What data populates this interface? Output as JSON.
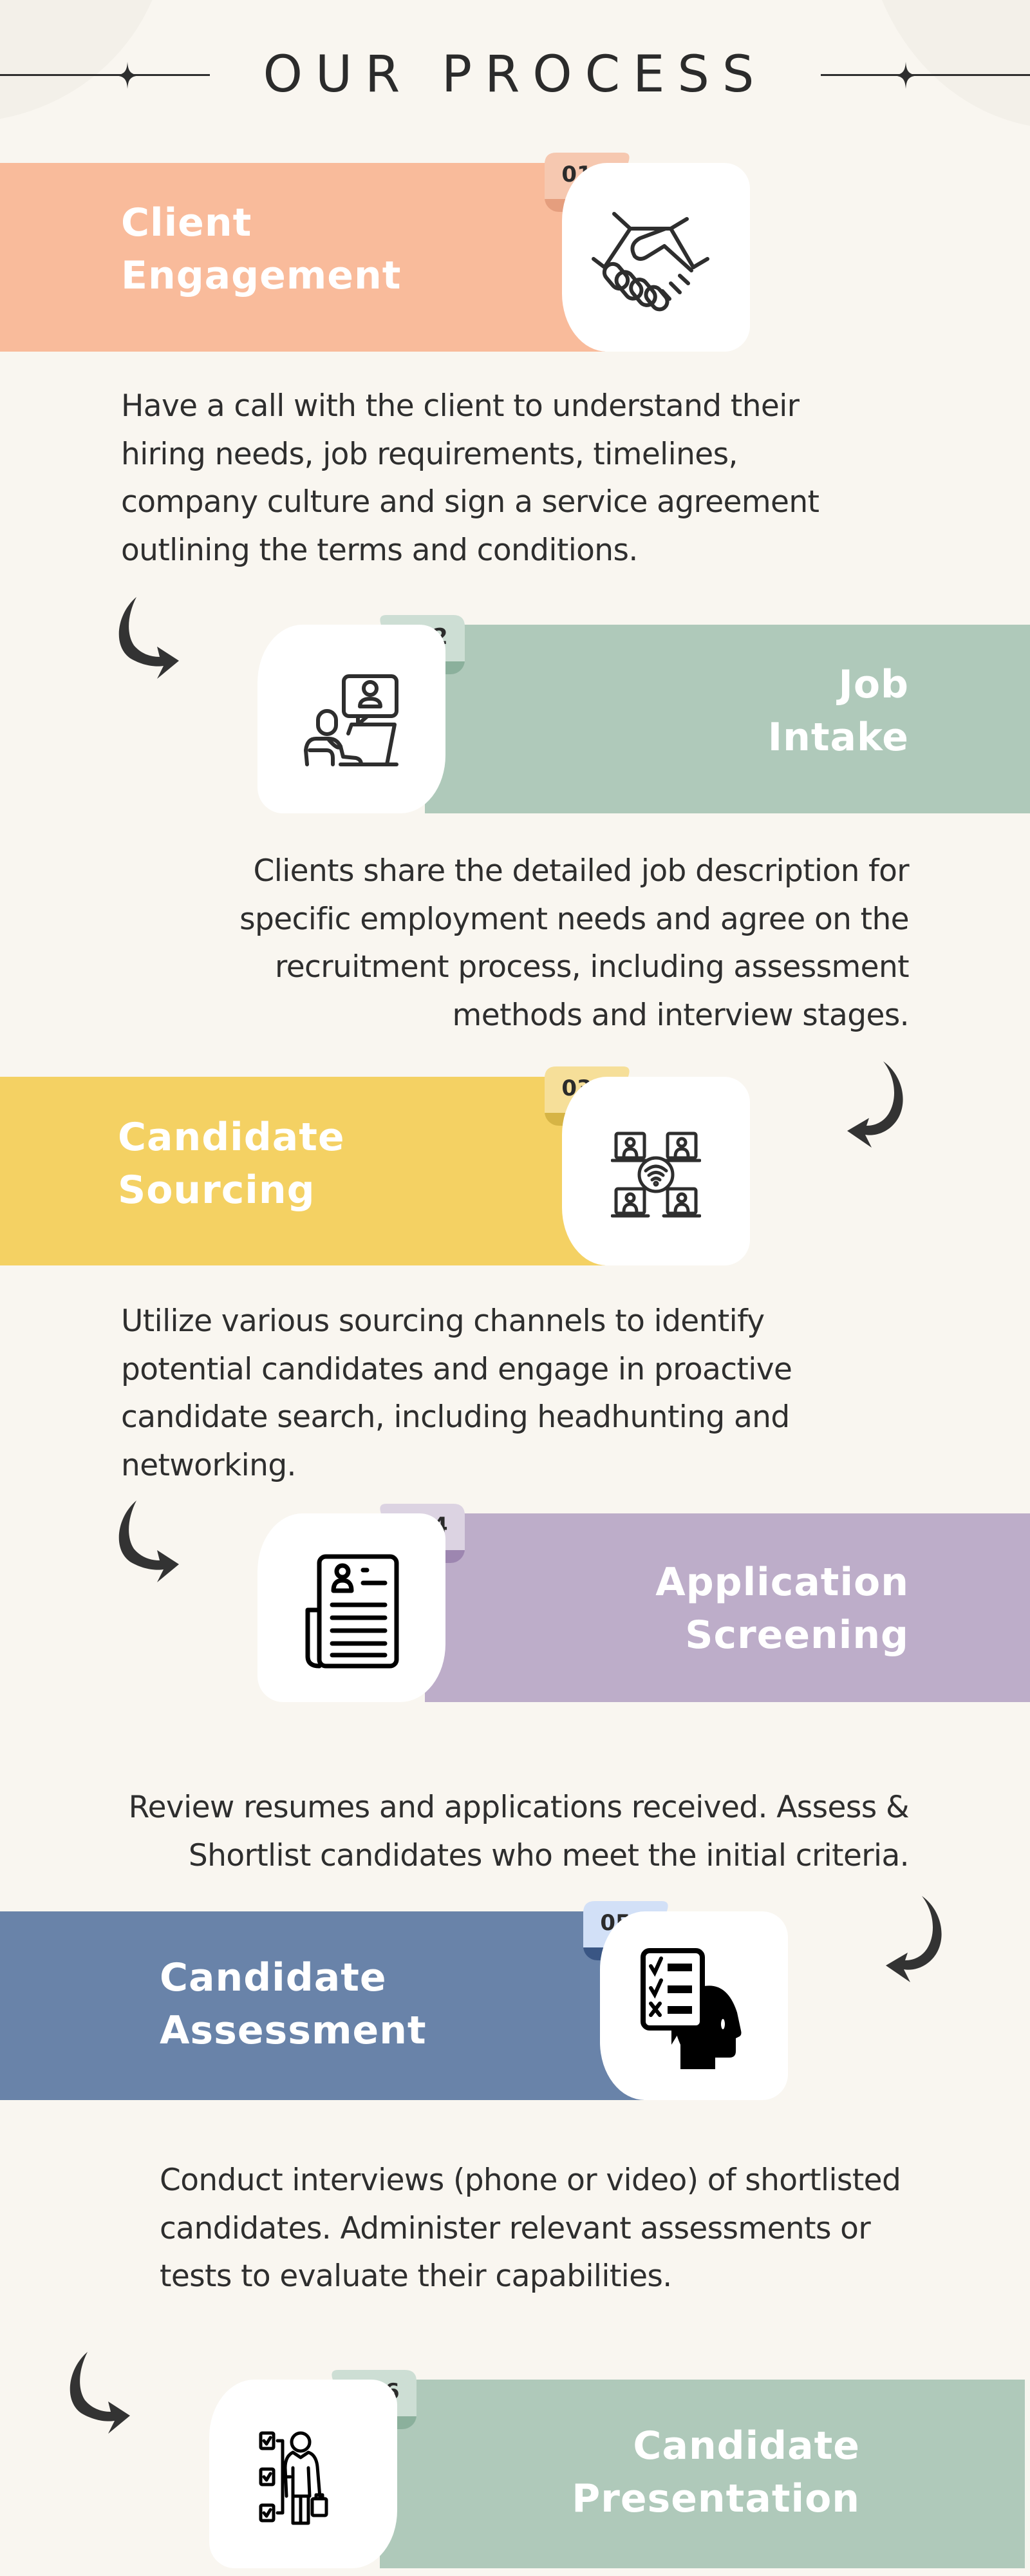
{
  "page": {
    "title": "OUR PROCESS",
    "background_color": "#f9f6f0",
    "text_color": "#2e2e2e"
  },
  "steps": [
    {
      "number": "01",
      "title_lines": [
        "Client",
        "Engagement"
      ],
      "icon": "handshake-icon",
      "banner_color": "#f9bb9b",
      "tab_color": "#f6c8b0",
      "fold_color": "#e59e7e",
      "description_lines": [
        "Have a call with the client to understand their",
        "hiring needs, job requirements, timelines,",
        "company culture and sign a service agreement",
        "outlining the terms and conditions."
      ]
    },
    {
      "number": "02",
      "title_lines": [
        "Job",
        "Intake"
      ],
      "icon": "video-call-person-icon",
      "banner_color": "#afc9ba",
      "tab_color": "#cdded4",
      "fold_color": "#8bb09c",
      "description_lines": [
        "Clients share the detailed job description for",
        "specific employment needs and agree on the",
        "recruitment process, including assessment",
        "methods and interview stages."
      ]
    },
    {
      "number": "03",
      "title_lines": [
        "Candidate",
        "Sourcing"
      ],
      "icon": "network-people-icon",
      "banner_color": "#f4d163",
      "tab_color": "#f6df99",
      "fold_color": "#d6b445",
      "description_lines": [
        "Utilize various sourcing channels to identify",
        "potential candidates and engage in proactive",
        "candidate search, including headhunting and",
        "networking."
      ]
    },
    {
      "number": "04",
      "title_lines": [
        "Application",
        "Screening"
      ],
      "icon": "resume-document-icon",
      "banner_color": "#bdadc9",
      "tab_color": "#dcd3e2",
      "fold_color": "#9d86b0",
      "description_lines": [
        "Review resumes and applications received. Assess &",
        "Shortlist candidates who meet the initial criteria."
      ]
    },
    {
      "number": "05",
      "title_lines": [
        "Candidate",
        "Assessment"
      ],
      "icon": "head-checklist-icon",
      "banner_color": "#6983a9",
      "tab_color": "#d2e0f7",
      "fold_color": "#3a5684",
      "description_lines": [
        "Conduct interviews (phone or video) of shortlisted",
        "candidates. Administer relevant assessments or",
        "tests to evaluate their capabilities."
      ]
    },
    {
      "number": "06",
      "title_lines": [
        "Candidate",
        "Presentation"
      ],
      "icon": "candidate-checklist-icon",
      "banner_color": "#afc9ba",
      "tab_color": "#cdded4",
      "fold_color": "#8bb09c",
      "description_lines": []
    }
  ]
}
